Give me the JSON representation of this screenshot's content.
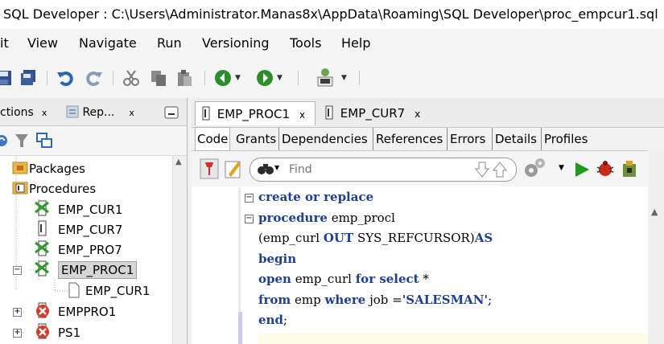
{
  "window": {
    "title": "SQL Developer : C:\\Users\\Administrator.Manas8x\\AppData\\Roaming\\SQL Developer\\proc_empcur1.sql"
  },
  "menu": {
    "items": [
      "it",
      "View",
      "Navigate",
      "Run",
      "Versioning",
      "Tools",
      "Help"
    ]
  },
  "left_panel": {
    "tabs": [
      {
        "label": "ctions",
        "close": "x"
      },
      {
        "label": "Rep...",
        "close": "x"
      }
    ],
    "tree": [
      {
        "label": "Packages"
      },
      {
        "label": "Procedures"
      },
      {
        "label": "EMP_CUR1"
      },
      {
        "label": "EMP_CUR7"
      },
      {
        "label": "EMP_PRO7"
      },
      {
        "label": "EMP_PROC1"
      },
      {
        "label": "EMP_CUR1"
      },
      {
        "label": "EMPPRO1"
      },
      {
        "label": "PS1"
      }
    ]
  },
  "editor": {
    "tabs": [
      {
        "label": "EMP_PROC1",
        "close": "x"
      },
      {
        "label": "EMP_CUR7",
        "close": "x"
      }
    ],
    "subtabs": [
      "Code",
      "Grants",
      "Dependencies",
      "References",
      "Errors",
      "Details",
      "Profiles"
    ],
    "find_placeholder": "Find",
    "code_lines": [
      [
        {
          "t": "create or replace",
          "k": true
        }
      ],
      [
        {
          "t": "procedure",
          "k": true
        },
        {
          "t": " emp_procl",
          "k": false
        }
      ],
      [
        {
          "t": "(emp_curl ",
          "k": false
        },
        {
          "t": "OUT",
          "k": true
        },
        {
          "t": " SYS_REFCURSOR)",
          "k": false
        },
        {
          "t": "AS",
          "k": true
        }
      ],
      [
        {
          "t": "begin",
          "k": true
        }
      ],
      [
        {
          "t": "open",
          "k": true
        },
        {
          "t": " emp_curl ",
          "k": false
        },
        {
          "t": "for select",
          "k": true
        },
        {
          "t": " *",
          "k": false
        }
      ],
      [
        {
          "t": "from",
          "k": true
        },
        {
          "t": " emp ",
          "k": false
        },
        {
          "t": "where",
          "k": true
        },
        {
          "t": " job =",
          "k": false
        },
        {
          "t": "'SALESMAN'",
          "k": true
        },
        {
          "t": ";",
          "k": false
        }
      ],
      [
        {
          "t": "end",
          "k": true
        },
        {
          "t": ";",
          "k": false
        }
      ]
    ]
  }
}
